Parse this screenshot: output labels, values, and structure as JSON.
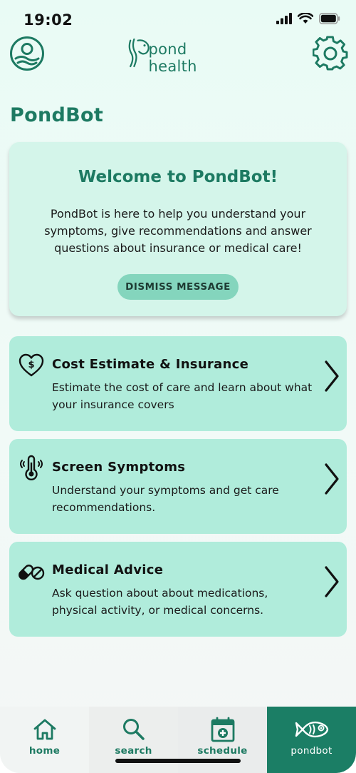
{
  "status_bar": {
    "time": "19:02"
  },
  "header": {
    "logo_text": "pond health"
  },
  "page": {
    "title": "PondBot"
  },
  "welcome": {
    "title": "Welcome to PondBot!",
    "body": "PondBot is here to help you understand your symptoms, give recommendations and answer questions about insurance or medical care!",
    "dismiss_label": "DISMISS MESSAGE"
  },
  "options": [
    {
      "icon": "heart-dollar-icon",
      "title": "Cost Estimate & Insurance",
      "description": "Estimate the cost of care and learn about what your insurance covers"
    },
    {
      "icon": "thermometer-icon",
      "title": "Screen Symptoms",
      "description": "Understand your symptoms and get care recommendations."
    },
    {
      "icon": "pills-icon",
      "title": "Medical Advice",
      "description": "Ask question about about medications, physical activity, or medical concerns."
    }
  ],
  "nav": [
    {
      "label": "home",
      "icon": "home-icon"
    },
    {
      "label": "search",
      "icon": "search-icon"
    },
    {
      "label": "schedule",
      "icon": "calendar-plus-icon"
    },
    {
      "label": "pondbot",
      "icon": "fish-icon",
      "active": true
    }
  ],
  "colors": {
    "primary": "#1d7a62",
    "card": "#b0ecdb",
    "welcome_card": "#d4f5ea",
    "active_nav": "#1b7e65"
  }
}
